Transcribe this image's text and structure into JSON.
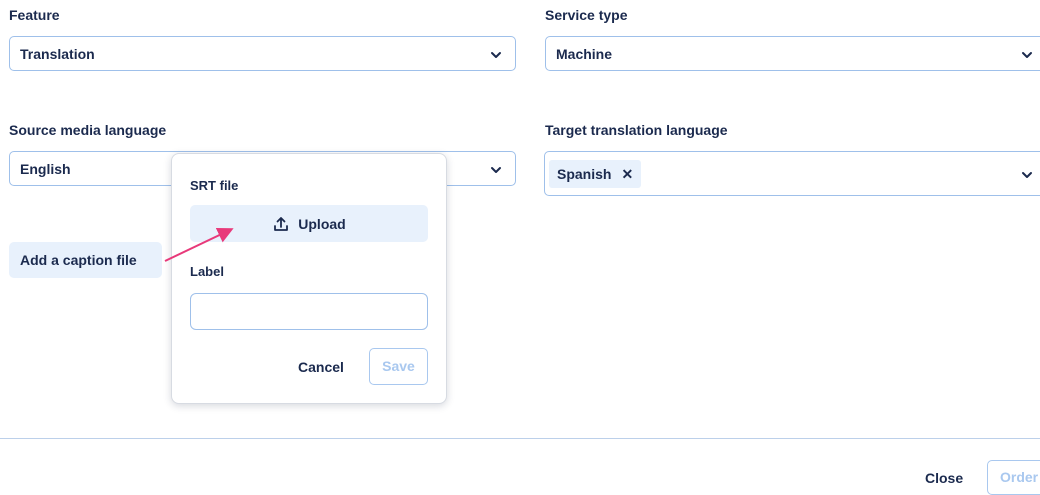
{
  "form": {
    "feature": {
      "label": "Feature",
      "value": "Translation"
    },
    "service_type": {
      "label": "Service type",
      "value": "Machine"
    },
    "source_language": {
      "label": "Source media language",
      "value": "English"
    },
    "target_language": {
      "label": "Target translation language",
      "chips": [
        "Spanish"
      ],
      "remove_glyph": "✕"
    }
  },
  "caption": {
    "add_button_label": "Add a caption file"
  },
  "popover": {
    "srt_label": "SRT file",
    "upload_label": "Upload",
    "label_field_label": "Label",
    "label_value": "",
    "cancel_label": "Cancel",
    "save_label": "Save"
  },
  "footer": {
    "close_label": "Close",
    "order_label": "Order"
  },
  "icons": {
    "chevron": "chevron-down-icon",
    "upload": "upload-icon",
    "remove": "close-icon"
  },
  "colors": {
    "text": "#1b2a4e",
    "border": "#9fc0ea",
    "chip_bg": "#e8f1fc",
    "disabled": "#a9c8ef",
    "annotation_arrow": "#e8397a"
  }
}
